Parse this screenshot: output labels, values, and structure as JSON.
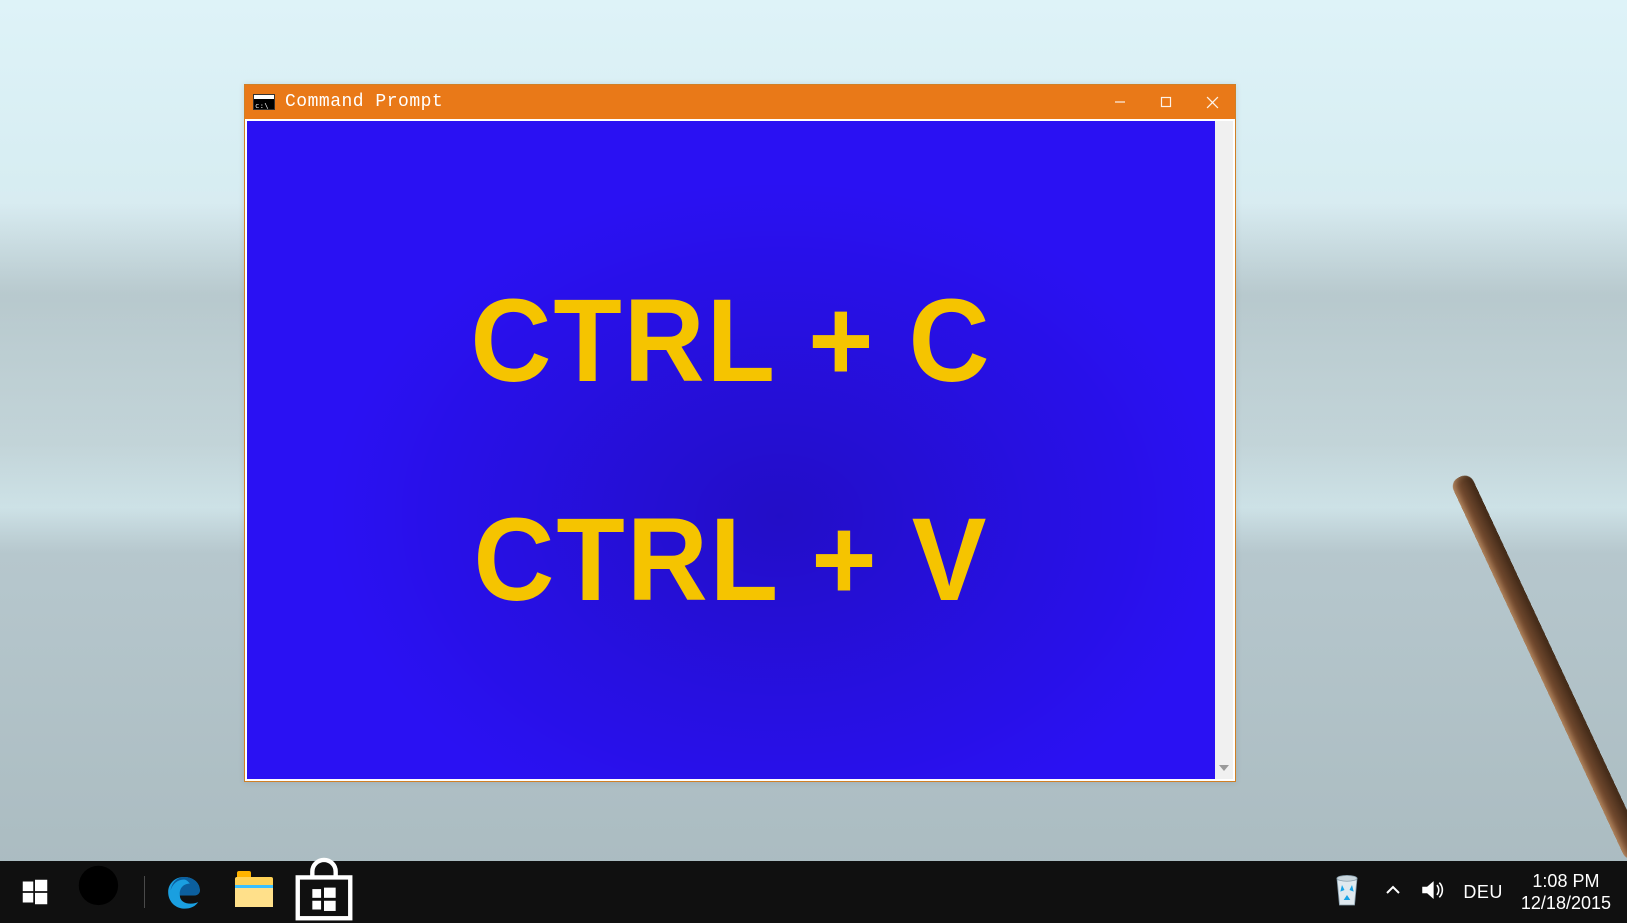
{
  "window": {
    "title": "Command Prompt",
    "controls": {
      "minimize": "Minimize",
      "maximize": "Maximize",
      "close": "Close"
    }
  },
  "console": {
    "line1": "CTRL + C",
    "line2": "CTRL + V"
  },
  "taskbar": {
    "start": "Start",
    "search": "Search",
    "apps": {
      "edge": "Microsoft Edge",
      "explorer": "File Explorer",
      "store": "Store"
    },
    "tray": {
      "recycle": "Recycle Bin",
      "overflow": "Show hidden icons",
      "sound": "Speakers",
      "language": "DEU",
      "time": "1:08 PM",
      "date": "12/18/2015"
    }
  },
  "colors": {
    "titlebar": "#e97918",
    "console_bg": "#2a11f3",
    "console_text": "#f5c400"
  }
}
